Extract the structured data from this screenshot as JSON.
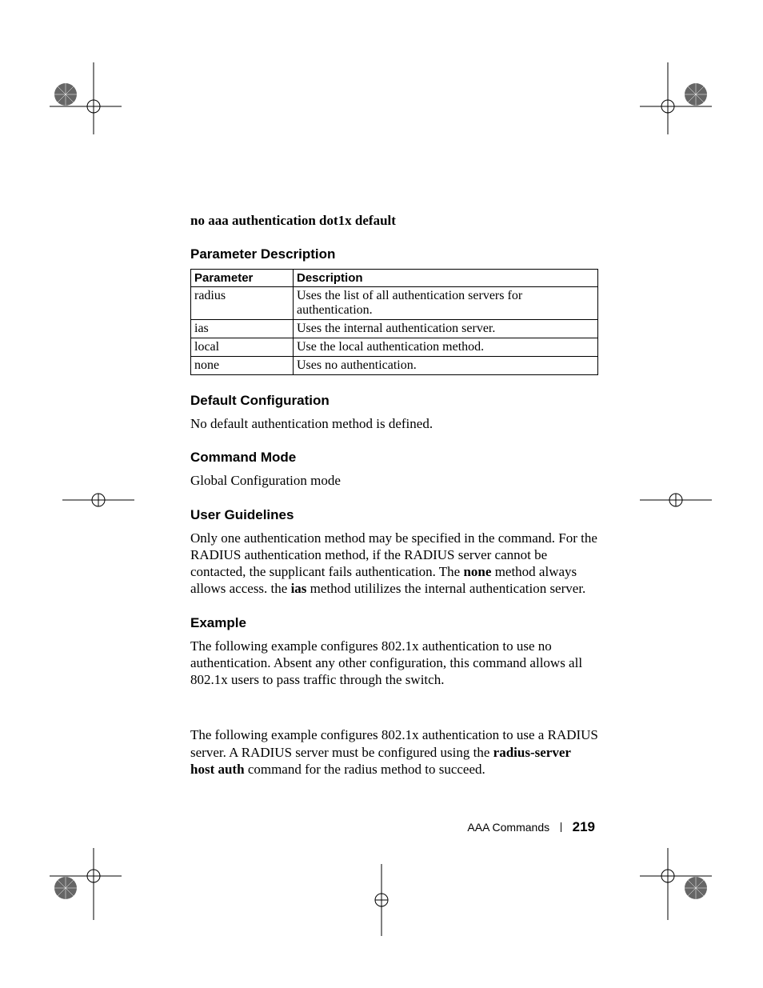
{
  "command_line": "no aaa authentication dot1x default",
  "sections": {
    "param_desc": "Parameter Description",
    "default_cfg": "Default Configuration",
    "cmd_mode": "Command Mode",
    "user_guide": "User Guidelines",
    "example": "Example"
  },
  "table": {
    "headers": {
      "param": "Parameter",
      "desc": "Description"
    },
    "rows": [
      {
        "param": "radius",
        "desc": "Uses the list of all authentication servers for authentication."
      },
      {
        "param": "ias",
        "desc": "Uses the internal authentication server."
      },
      {
        "param": "local",
        "desc": "Use the local authentication method."
      },
      {
        "param": "none",
        "desc": "Uses no authentication."
      }
    ]
  },
  "default_cfg_text": "No default authentication method is defined.",
  "cmd_mode_text": "Global Configuration mode",
  "user_guide_parts": {
    "p1": "Only one authentication method may be specified in the command. For the RADIUS authentication method, if the RADIUS server cannot be contacted, the supplicant fails authentication. The ",
    "none": "none",
    "p2": " method always allows access. the ",
    "ias": "ias",
    "p3": " method utililizes the internal authentication server."
  },
  "example_text1": "The following example configures 802.1x authentication to use no authentication. Absent any other configuration, this command allows all 802.1x users to pass traffic through the switch.",
  "example_text2_parts": {
    "p1": "The following example configures 802.1x authentication to use a RADIUS server. A RADIUS server must be configured using the ",
    "bold": "radius-server host auth",
    "p2": " command for the radius method to succeed."
  },
  "footer": {
    "chapter": "AAA Commands",
    "page": "219"
  }
}
